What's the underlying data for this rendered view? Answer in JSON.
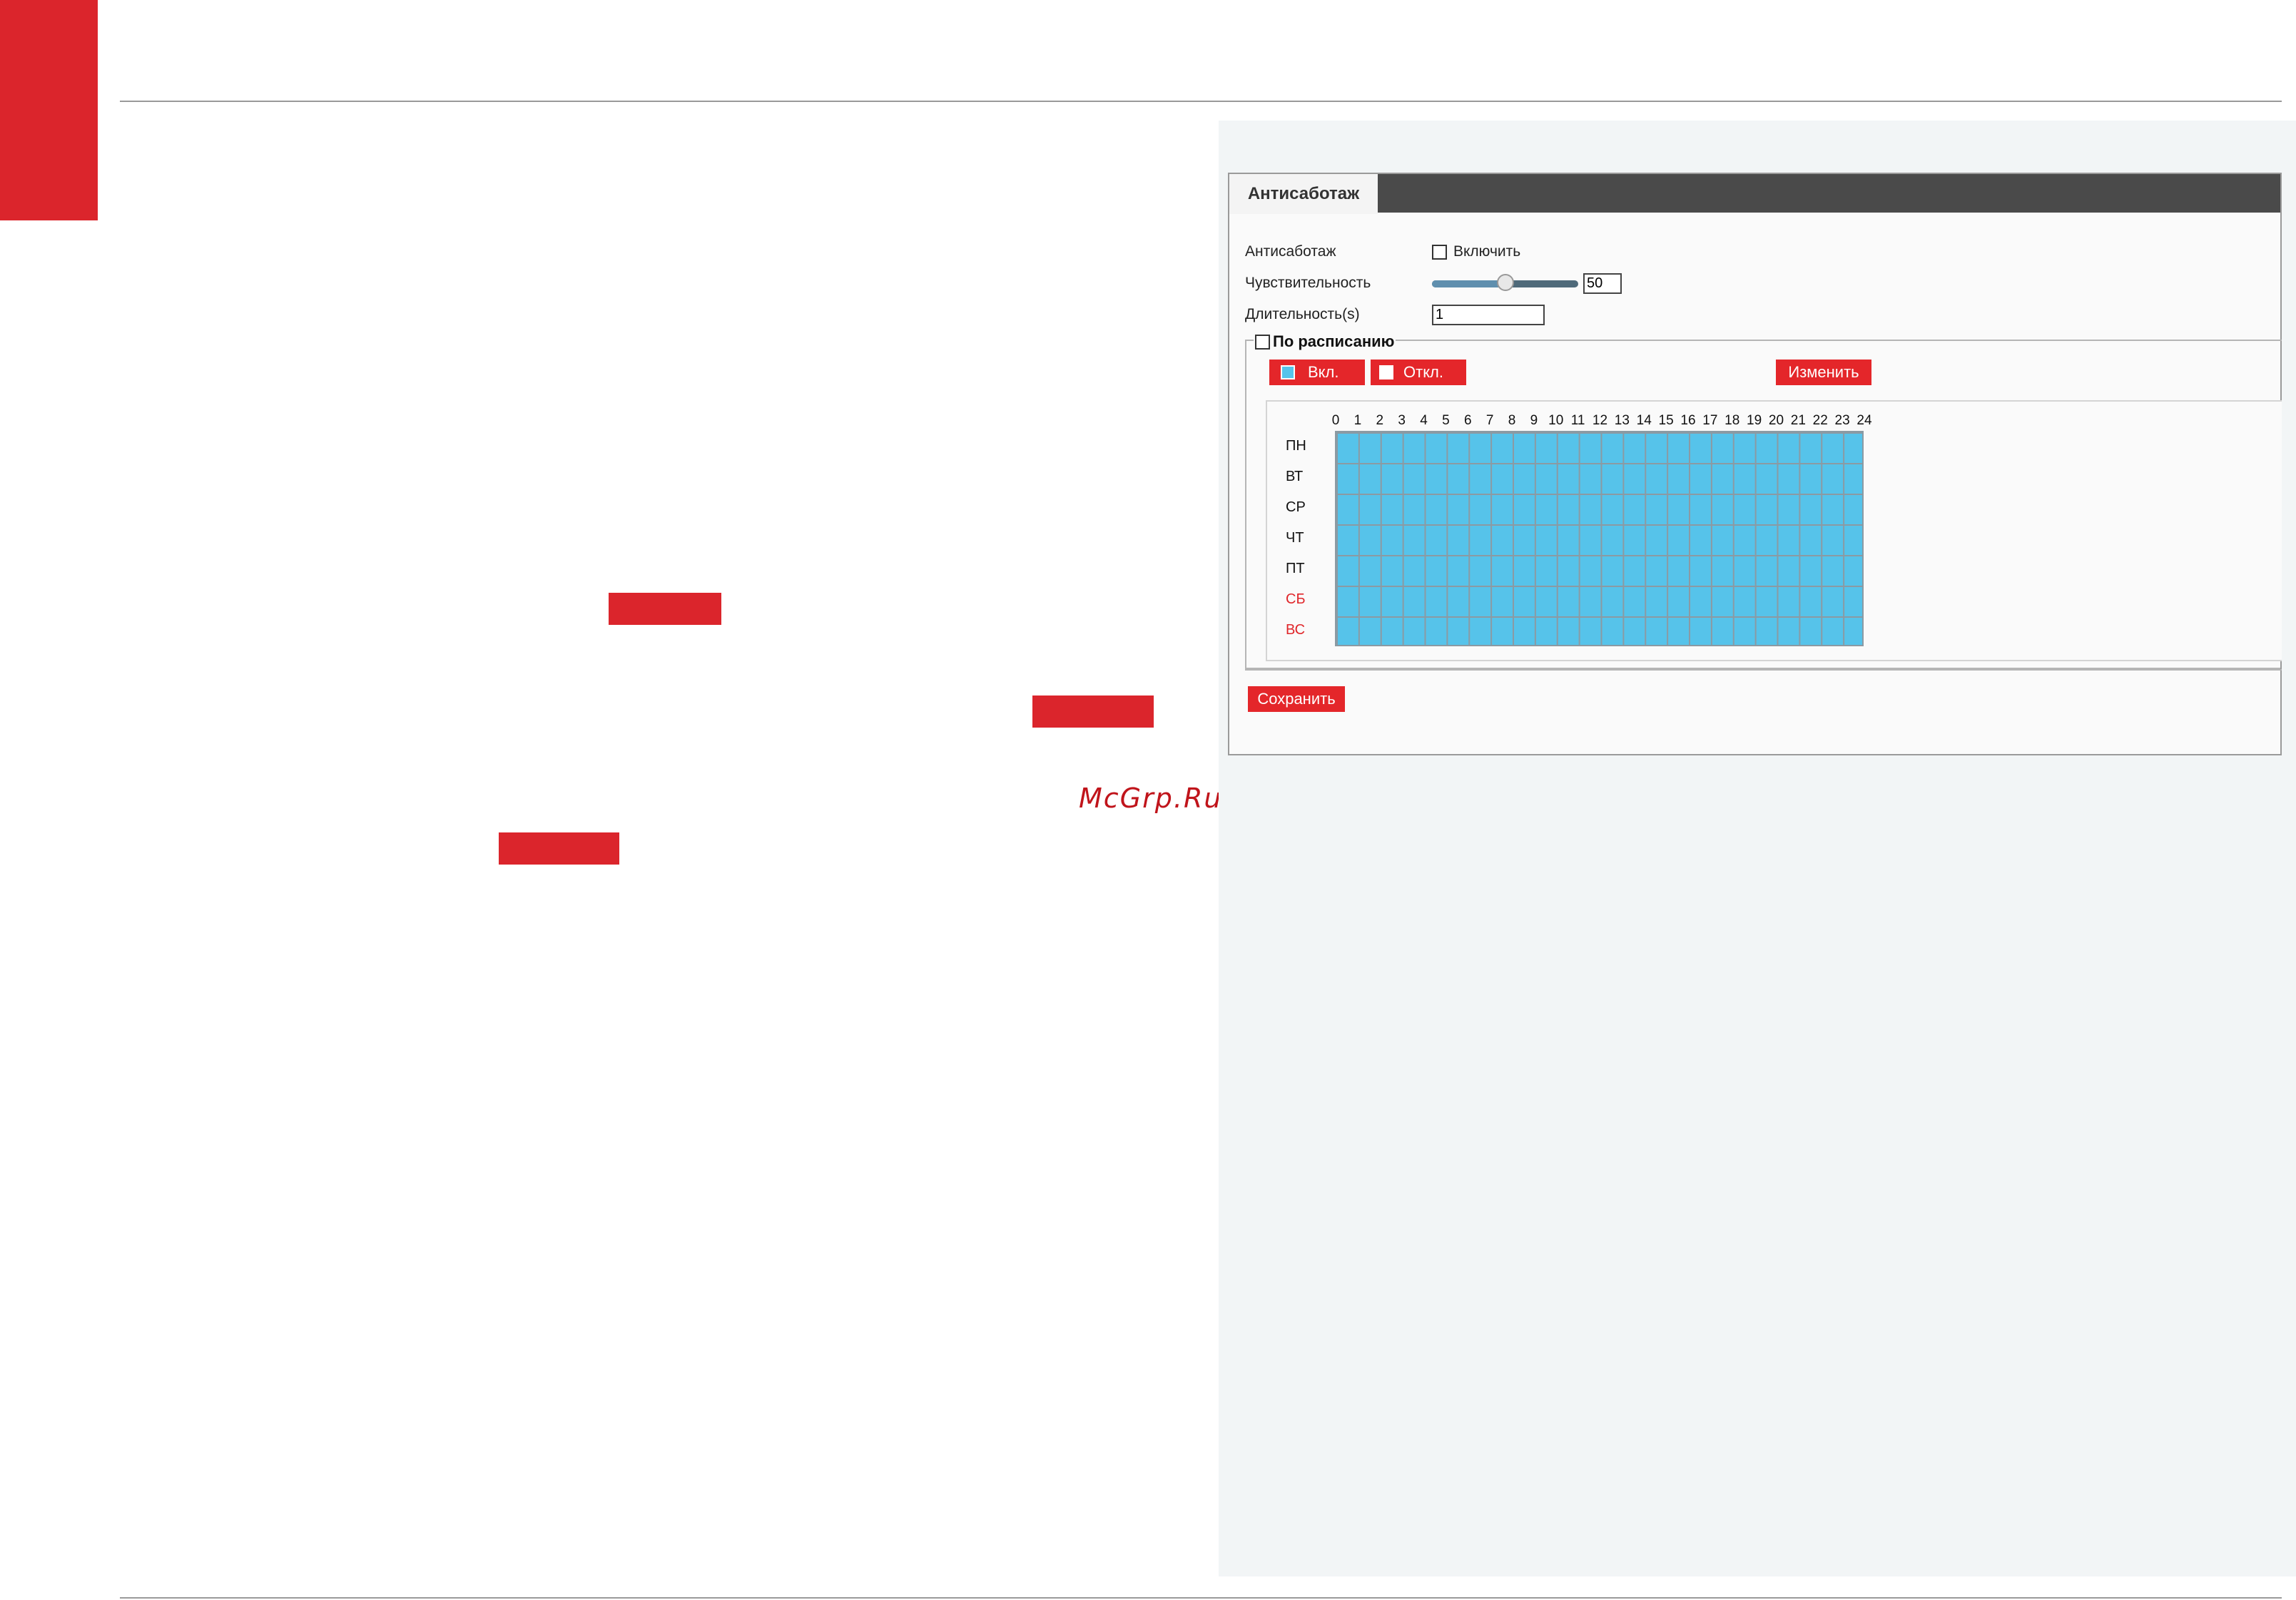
{
  "colors": {
    "brand_red": "#db252c",
    "button_red": "#e4262a",
    "schedule_on": "#56c3ea",
    "weekend_text": "#e0262a"
  },
  "watermark": "McGrp.Ru",
  "window": {
    "tab_title": "Антисаботаж",
    "form": {
      "antisabotage_label": "Антисаботаж",
      "enable_label": "Включить",
      "enable_checked": false,
      "sensitivity_label": "Чувствительность",
      "sensitivity_value": "50",
      "sensitivity_min": 0,
      "sensitivity_max": 100,
      "duration_label": "Длительность(s)",
      "duration_value": "1"
    },
    "schedule": {
      "label": "По расписанию",
      "checked": false,
      "on_label": "Вкл.",
      "off_label": "Откл.",
      "change_label": "Изменить",
      "hours": [
        "0",
        "1",
        "2",
        "3",
        "4",
        "5",
        "6",
        "7",
        "8",
        "9",
        "10",
        "11",
        "12",
        "13",
        "14",
        "15",
        "16",
        "17",
        "18",
        "19",
        "20",
        "21",
        "22",
        "23",
        "24"
      ],
      "days": [
        {
          "label": "ПН",
          "weekend": false
        },
        {
          "label": "ВТ",
          "weekend": false
        },
        {
          "label": "СР",
          "weekend": false
        },
        {
          "label": "ЧТ",
          "weekend": false
        },
        {
          "label": "ПТ",
          "weekend": false
        },
        {
          "label": "СБ",
          "weekend": true
        },
        {
          "label": "ВС",
          "weekend": true
        }
      ],
      "all_slots_on": true
    },
    "save_label": "Сохранить"
  }
}
